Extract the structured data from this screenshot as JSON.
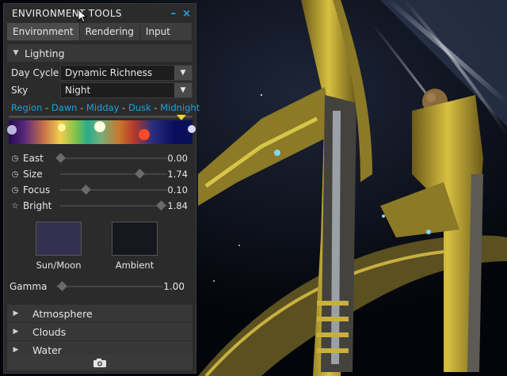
{
  "window": {
    "title": "ENVIRONMENT TOOLS",
    "minimize_glyph": "–",
    "close_glyph": "×"
  },
  "tabs": [
    {
      "label": "Environment",
      "active": true
    },
    {
      "label": "Rendering",
      "active": false
    },
    {
      "label": "Input",
      "active": false
    }
  ],
  "lighting": {
    "header": "Lighting",
    "day_cycle": {
      "label": "Day Cycle",
      "value": "Dynamic Richness"
    },
    "sky": {
      "label": "Sky",
      "value": "Night"
    },
    "time_labels": [
      "Region",
      "Dawn",
      "Midday",
      "Dusk",
      "Midnight"
    ],
    "time_separator": " - ",
    "sliders": [
      {
        "icon": "clock-icon",
        "glyph": "◷",
        "label": "East",
        "value": "0.00",
        "level": 0.0
      },
      {
        "icon": "clock-icon",
        "glyph": "◷",
        "label": "Size",
        "value": "1.74",
        "level": 0.74
      },
      {
        "icon": "clock-icon",
        "glyph": "◷",
        "label": "Focus",
        "value": "0.10",
        "level": 0.24
      },
      {
        "icon": "star-icon",
        "glyph": "☆",
        "label": "Bright",
        "value": "1.84",
        "level": 0.94
      }
    ],
    "sun_moon": {
      "label": "Sun/Moon",
      "color": "#34304f"
    },
    "ambient": {
      "label": "Ambient",
      "color": "#17171f"
    },
    "gamma": {
      "label": "Gamma",
      "value": "1.00",
      "level": 0.05
    }
  },
  "sections": [
    {
      "label": "Atmosphere"
    },
    {
      "label": "Clouds"
    },
    {
      "label": "Water"
    }
  ],
  "colors": {
    "accent": "#25a7e2",
    "panel": "#2b2b2b",
    "marker": "#f0d230"
  }
}
